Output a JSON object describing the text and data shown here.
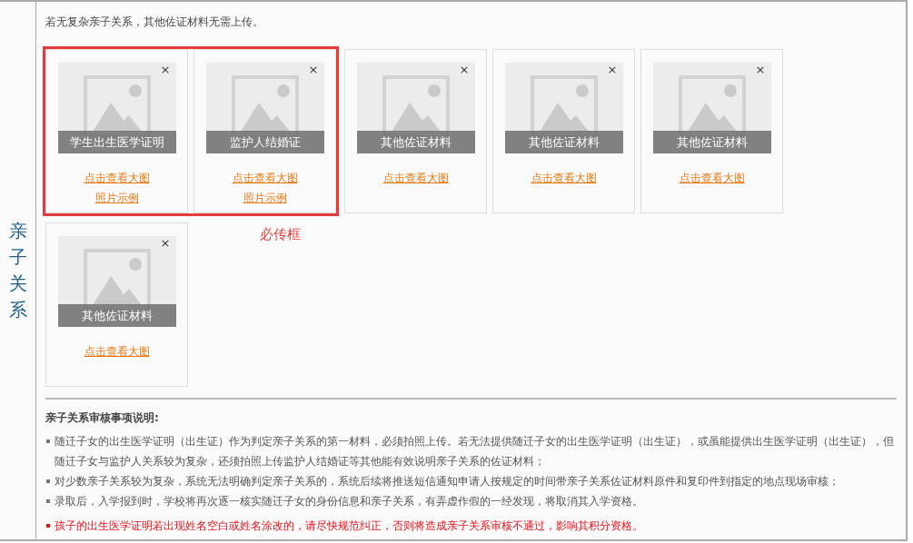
{
  "section_label": "亲子关系",
  "instruction": "若无复杂亲子关系，其他佐证材料无需上传。",
  "required_frame_label": "必传框",
  "cards": [
    {
      "label": "学生出生医学证明",
      "close": "×",
      "required": true,
      "links": [
        "点击查看大图",
        "照片示例"
      ]
    },
    {
      "label": "监护人结婚证",
      "close": "×",
      "required": true,
      "links": [
        "点击查看大图",
        "照片示例"
      ]
    },
    {
      "label": "其他佐证材料",
      "close": "×",
      "required": false,
      "links": [
        "点击查看大图"
      ]
    },
    {
      "label": "其他佐证材料",
      "close": "×",
      "required": false,
      "links": [
        "点击查看大图"
      ]
    },
    {
      "label": "其他佐证材料",
      "close": "×",
      "required": false,
      "links": [
        "点击查看大图"
      ]
    },
    {
      "label": "其他佐证材料",
      "close": "×",
      "required": false,
      "links": [
        "点击查看大图"
      ]
    }
  ],
  "notes": {
    "title": "亲子关系审核事项说明:",
    "items": [
      {
        "kind": "normal",
        "text": "随迁子女的出生医学证明（出生证）作为判定亲子关系的第一材料，必须拍照上传。若无法提供随迁子女的出生医学证明（出生证），或虽能提供出生医学证明（出生证），但随迁子女与监护人关系较为复杂，还须拍照上传监护人结婚证等其他能有效说明亲子关系的佐证材料；"
      },
      {
        "kind": "normal",
        "text": "对少数亲子关系较为复杂，系统无法明确判定亲子关系的，系统后续将推送短信通知申请人按规定的时间带亲子关系佐证材料原件和复印件到指定的地点现场审核；"
      },
      {
        "kind": "normal",
        "text": "录取后，入学报到时，学校将再次逐一核实随迁子女的身份信息和亲子关系，有弄虚作假的一经发现，将取消其入学资格。"
      },
      {
        "kind": "warning",
        "text": "孩子的出生医学证明若出现姓名空白或姓名涂改的，请尽快规范纠正，否则将造成亲子关系审核不通过，影响其积分资格。"
      }
    ]
  }
}
